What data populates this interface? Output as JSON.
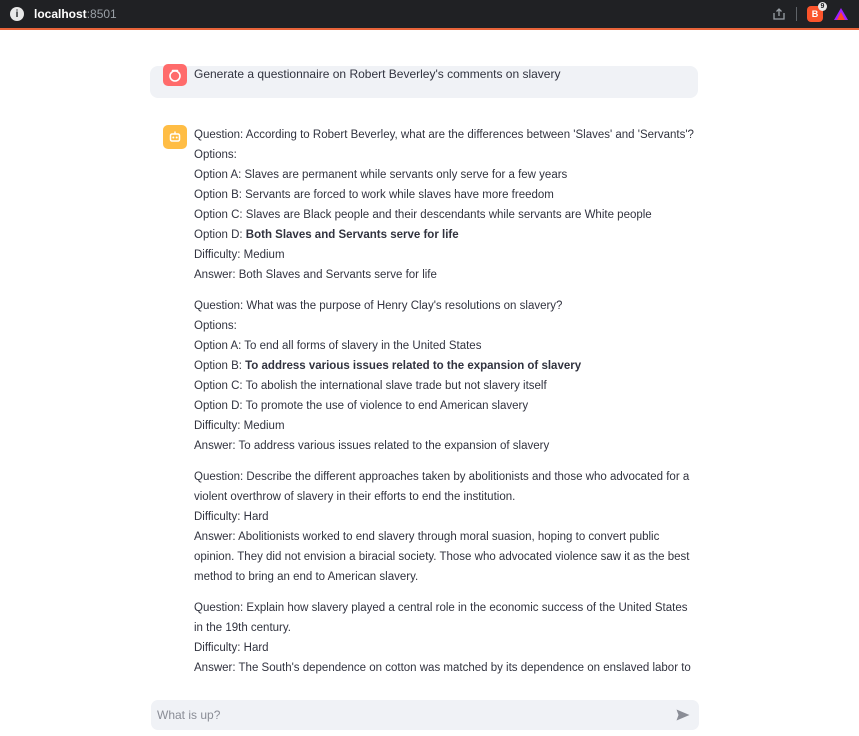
{
  "browser": {
    "host": "localhost",
    "port": ":8501",
    "brave_badge": "9"
  },
  "colors": {
    "user_avatar": "#ff6b6b",
    "bot_avatar": "#ffbd45",
    "bubble": "#f0f2f6",
    "text": "#31333f"
  },
  "chat": {
    "user_message": "Generate a questionnaire on Robert Beverley's comments on slavery",
    "blocks": [
      {
        "lines": [
          {
            "text": "Question: According to Robert Beverley, what are the differences between 'Slaves' and 'Servants'?"
          },
          {
            "text": "Options:"
          },
          {
            "text": "Option A: Slaves are permanent while servants only serve for a few years"
          },
          {
            "text": "Option B: Servants are forced to work while slaves have more freedom"
          },
          {
            "text": "Option C: Slaves are Black people and their descendants while servants are White people"
          },
          {
            "prefix": "Option D: ",
            "bold": "Both Slaves and Servants serve for life"
          },
          {
            "text": "Difficulty: Medium"
          },
          {
            "text": "Answer: Both Slaves and Servants serve for life"
          }
        ]
      },
      {
        "lines": [
          {
            "text": "Question: What was the purpose of Henry Clay's resolutions on slavery?"
          },
          {
            "text": "Options:"
          },
          {
            "text": "Option A: To end all forms of slavery in the United States"
          },
          {
            "prefix": "Option B: ",
            "bold": "To address various issues related to the expansion of slavery"
          },
          {
            "text": "Option C: To abolish the international slave trade but not slavery itself"
          },
          {
            "text": "Option D: To promote the use of violence to end American slavery"
          },
          {
            "text": "Difficulty: Medium"
          },
          {
            "text": "Answer: To address various issues related to the expansion of slavery"
          }
        ]
      },
      {
        "lines": [
          {
            "text": "Question: Describe the different approaches taken by abolitionists and those who advocated for a"
          },
          {
            "text": "violent overthrow of slavery in their efforts to end the institution."
          },
          {
            "text": "Difficulty: Hard"
          },
          {
            "text": "Answer: Abolitionists worked to end slavery through moral suasion, hoping to convert public"
          },
          {
            "text": "opinion. They did not envision a biracial society. Those who advocated violence saw it as the best"
          },
          {
            "text": "method to bring an end to American slavery."
          }
        ]
      },
      {
        "lines": [
          {
            "text": "Question: Explain how slavery played a central role in the economic success of the United States"
          },
          {
            "text": "in the 19th century."
          },
          {
            "text": "Difficulty: Hard"
          },
          {
            "text": "Answer: The South's dependence on cotton was matched by its dependence on enslaved labor to"
          }
        ]
      }
    ]
  },
  "input": {
    "placeholder": "What is up?"
  },
  "icons": {
    "site_info": "info-icon",
    "share": "share-icon",
    "brave": "brave-shields-icon",
    "rewards": "brave-rewards-icon",
    "user_avatar": "user-face-icon",
    "bot_avatar": "robot-face-icon",
    "send": "send-arrow-icon"
  }
}
